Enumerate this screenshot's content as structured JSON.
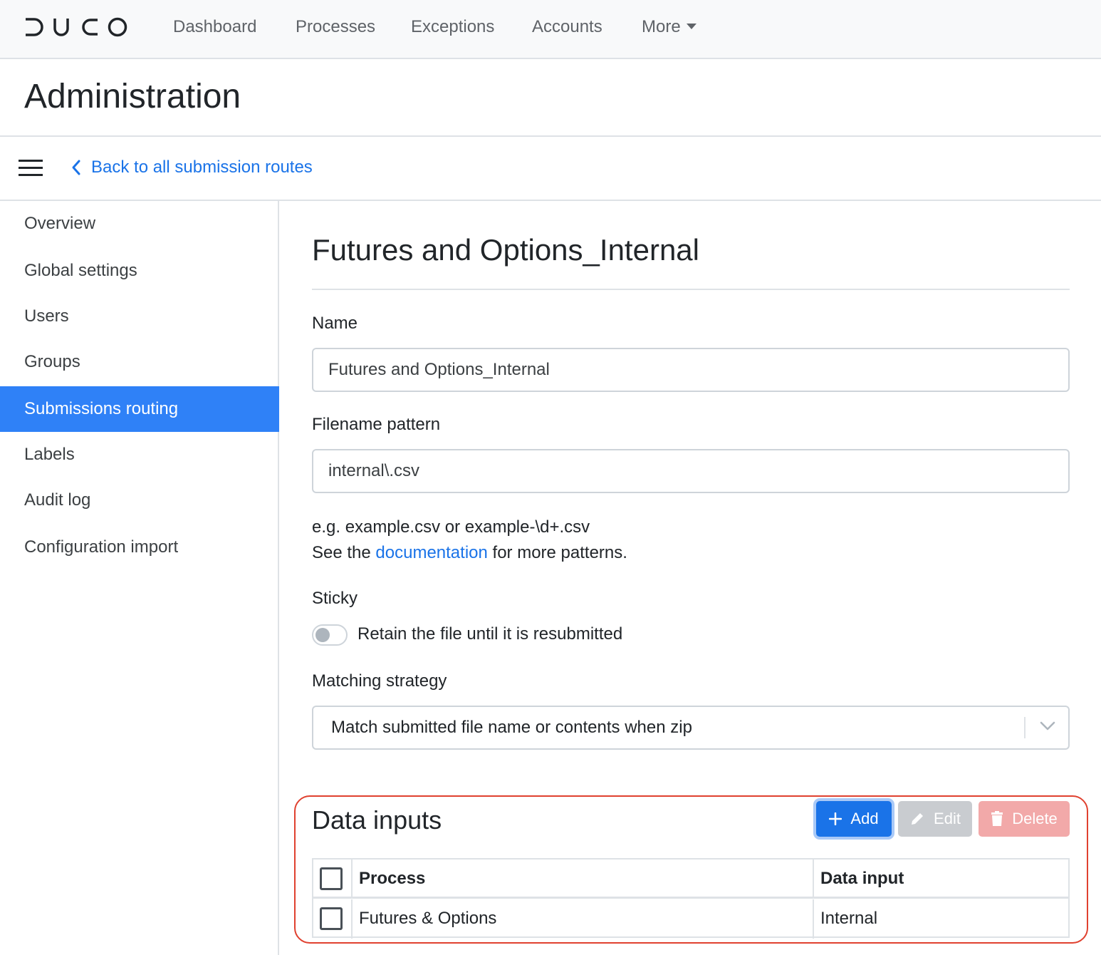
{
  "nav": {
    "logo": "DUCO",
    "items": [
      {
        "label": "Dashboard"
      },
      {
        "label": "Processes"
      },
      {
        "label": "Exceptions"
      },
      {
        "label": "Accounts"
      },
      {
        "label": "More"
      }
    ]
  },
  "page": {
    "title": "Administration"
  },
  "toolbar": {
    "back_label": "Back to all submission routes"
  },
  "sidebar": {
    "active": "Submissions routing",
    "items": [
      {
        "label": "Overview"
      },
      {
        "label": "Global settings"
      },
      {
        "label": "Users"
      },
      {
        "label": "Groups"
      },
      {
        "label": "Submissions routing"
      },
      {
        "label": "Labels"
      },
      {
        "label": "Audit log"
      },
      {
        "label": "Configuration import"
      }
    ]
  },
  "form": {
    "title": "Futures and Options_Internal",
    "name": {
      "label": "Name",
      "value": "Futures and Options_Internal"
    },
    "filename": {
      "label": "Filename pattern",
      "value": "internal\\.csv",
      "help_line1": "e.g. example.csv or example-\\d+.csv",
      "help_prefix": "See the",
      "help_link": "documentation",
      "help_suffix": "for more patterns."
    },
    "sticky": {
      "label": "Sticky",
      "toggle_label": "Retain the file until it is resubmitted",
      "enabled": false
    },
    "matching": {
      "label": "Matching strategy",
      "value": "Match submitted file name or contents when zip"
    }
  },
  "data_inputs": {
    "title": "Data inputs",
    "buttons": {
      "add": "Add",
      "edit": "Edit",
      "delete": "Delete"
    },
    "columns": [
      "Process",
      "Data input"
    ],
    "rows": [
      {
        "process": "Futures & Options",
        "data_input": "Internal",
        "checked": false
      }
    ]
  },
  "colors": {
    "accent": "#1a73e8",
    "active_sidebar": "#2f81f7",
    "highlight": "#e0412f"
  }
}
